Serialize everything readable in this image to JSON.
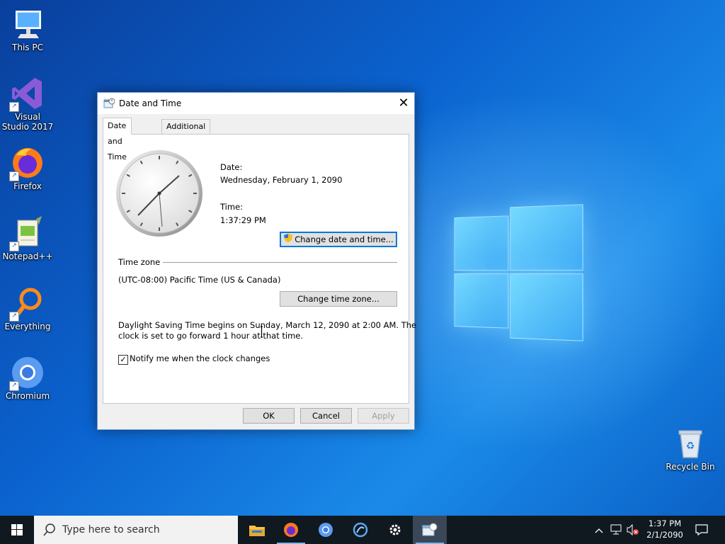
{
  "desktop": {
    "icons": [
      {
        "label": "This PC",
        "icon": "computer-icon"
      },
      {
        "label": "Visual Studio 2017",
        "icon": "visual-studio-icon"
      },
      {
        "label": "Firefox",
        "icon": "firefox-icon"
      },
      {
        "label": "Notepad++",
        "icon": "notepadpp-icon"
      },
      {
        "label": "Everything",
        "icon": "everything-search-icon"
      },
      {
        "label": "Chromium",
        "icon": "chromium-icon"
      }
    ],
    "recycle_bin": {
      "label": "Recycle Bin",
      "icon": "recycle-bin-icon"
    }
  },
  "dialog": {
    "title": "Date and Time",
    "close_glyph": "✕",
    "tabs": [
      {
        "label": "Date and Time",
        "active": true
      },
      {
        "label": "Additional Clocks",
        "active": false
      }
    ],
    "date_label": "Date:",
    "date_value": "Wednesday, February 1, 2090",
    "time_label": "Time:",
    "time_value": "1:37:29 PM",
    "change_datetime_button": "Change date and time...",
    "timezone_section": "Time zone",
    "timezone_value": "(UTC-08:00) Pacific Time (US & Canada)",
    "change_timezone_button": "Change time zone...",
    "dst_line1": "Daylight Saving Time begins on Sunday, March 12, 2090 at 2:00 AM. The",
    "dst_line2": "clock is set to go forward 1 hour at that time.",
    "notify_label": "Notify me when the clock changes",
    "notify_checked": true,
    "buttons": {
      "ok": "OK",
      "cancel": "Cancel",
      "apply": "Apply"
    }
  },
  "taskbar": {
    "search_placeholder": "Type here to search",
    "pinned": [
      "file-explorer-icon",
      "firefox-icon",
      "chromium-icon",
      "edge-like-icon",
      "settings-icon",
      "date-time-icon"
    ],
    "clock_time": "1:37 PM",
    "clock_date": "2/1/2090"
  },
  "colors": {
    "accent": "#0078d7",
    "taskbar": "#101820",
    "desktop": "#0b63cf"
  }
}
